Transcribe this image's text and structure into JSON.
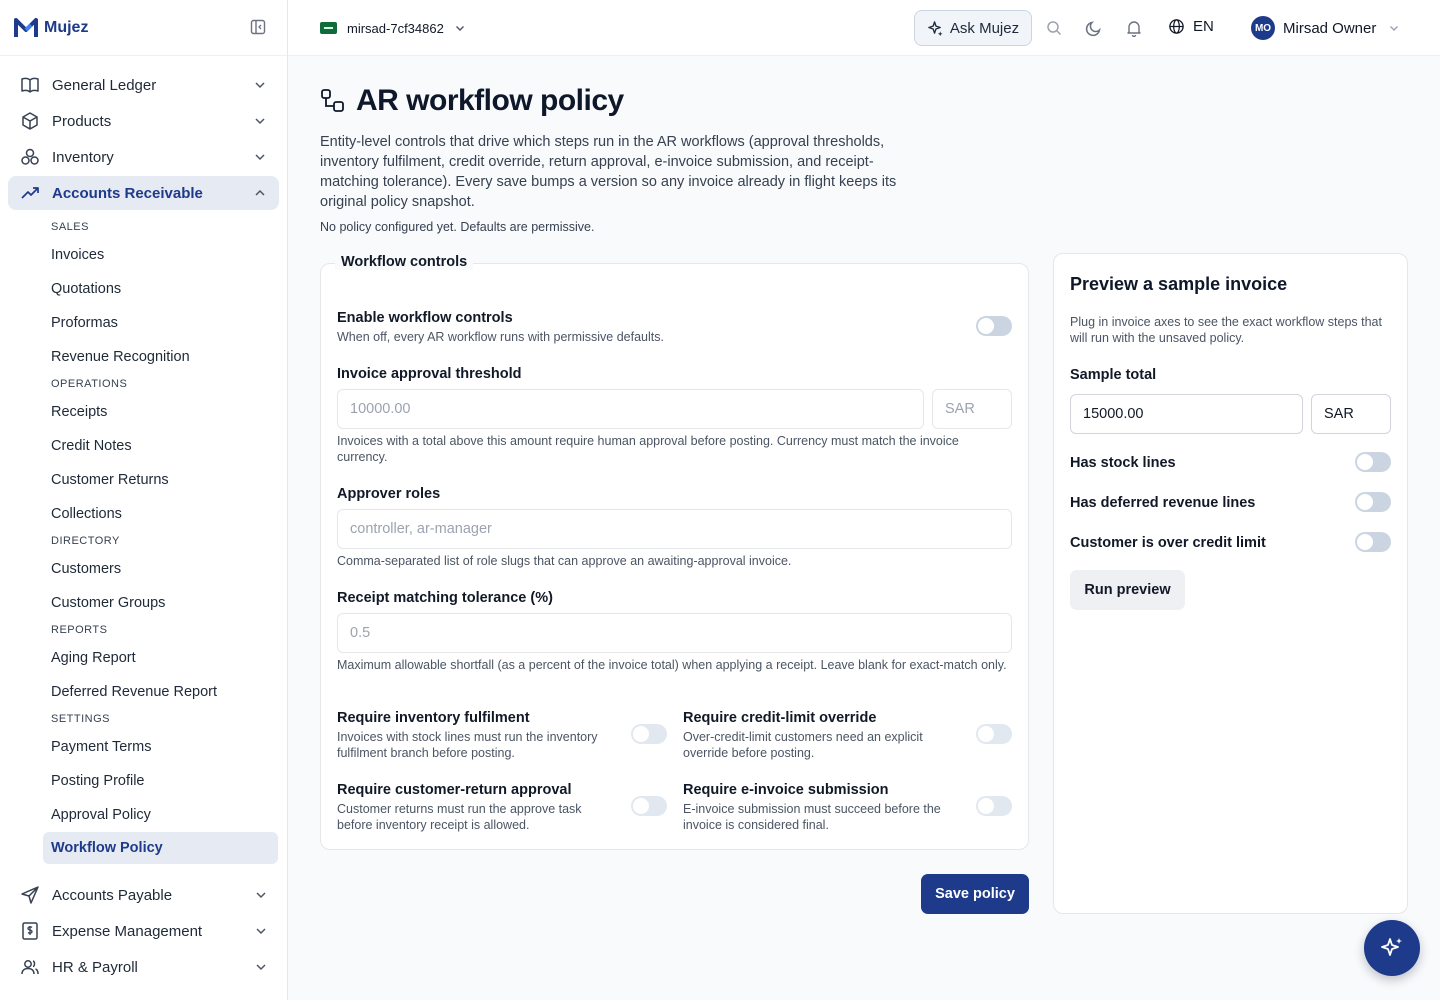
{
  "brand": {
    "name": "Mujez"
  },
  "topbar": {
    "entity": "mirsad-7cf34862",
    "ask_label": "Ask Mujez",
    "language": "EN",
    "user_initials": "MO",
    "user_name": "Mirsad Owner"
  },
  "sidebar": {
    "top_items": [
      {
        "label": "General Ledger",
        "icon": "book-icon"
      },
      {
        "label": "Products",
        "icon": "cube-icon"
      },
      {
        "label": "Inventory",
        "icon": "boxes-icon"
      },
      {
        "label": "Accounts Receivable",
        "icon": "trending-up-icon"
      }
    ],
    "ar_sections": [
      {
        "title": "SALES",
        "items": [
          "Invoices",
          "Quotations",
          "Proformas",
          "Revenue Recognition"
        ]
      },
      {
        "title": "OPERATIONS",
        "items": [
          "Receipts",
          "Credit Notes",
          "Customer Returns",
          "Collections"
        ]
      },
      {
        "title": "DIRECTORY",
        "items": [
          "Customers",
          "Customer Groups"
        ]
      },
      {
        "title": "REPORTS",
        "items": [
          "Aging Report",
          "Deferred Revenue Report"
        ]
      },
      {
        "title": "SETTINGS",
        "items": [
          "Payment Terms",
          "Posting Profile",
          "Approval Policy",
          "Workflow Policy"
        ]
      }
    ],
    "bottom_items": [
      {
        "label": "Accounts Payable",
        "icon": "send-icon"
      },
      {
        "label": "Expense Management",
        "icon": "receipt-icon"
      },
      {
        "label": "HR & Payroll",
        "icon": "users-icon"
      }
    ]
  },
  "page": {
    "title": "AR workflow policy",
    "description": "Entity-level controls that drive which steps run in the AR workflows (approval thresholds, inventory fulfilment, credit override, return approval, e-invoice submission, and receipt-matching tolerance). Every save bumps a version so any invoice already in flight keeps its original policy snapshot.",
    "note": "No policy configured yet. Defaults are permissive."
  },
  "workflow": {
    "legend": "Workflow controls",
    "enable_label": "Enable workflow controls",
    "enable_help": "When off, every AR workflow runs with permissive defaults.",
    "threshold_label": "Invoice approval threshold",
    "threshold_placeholder": "10000.00",
    "currency_placeholder": "SAR",
    "threshold_help": "Invoices with a total above this amount require human approval before posting. Currency must match the invoice currency.",
    "approver_label": "Approver roles",
    "approver_placeholder": "controller, ar-manager",
    "approver_help": "Comma-separated list of role slugs that can approve an awaiting-approval invoice.",
    "tolerance_label": "Receipt matching tolerance (%)",
    "tolerance_placeholder": "0.5",
    "tolerance_help": "Maximum allowable shortfall (as a percent of the invoice total) when applying a receipt. Leave blank for exact-match only.",
    "toggles": [
      {
        "label": "Require inventory fulfilment",
        "help": "Invoices with stock lines must run the inventory fulfilment branch before posting."
      },
      {
        "label": "Require credit-limit override",
        "help": "Over-credit-limit customers need an explicit override before posting."
      },
      {
        "label": "Require customer-return approval",
        "help": "Customer returns must run the approve task before inventory receipt is allowed."
      },
      {
        "label": "Require e-invoice submission",
        "help": "E-invoice submission must succeed before the invoice is considered final."
      }
    ],
    "save_label": "Save policy"
  },
  "preview": {
    "title": "Preview a sample invoice",
    "help": "Plug in invoice axes to see the exact workflow steps that will run with the unsaved policy.",
    "total_label": "Sample total",
    "total_value": "15000.00",
    "currency_value": "SAR",
    "toggles": [
      "Has stock lines",
      "Has deferred revenue lines",
      "Customer is over credit limit"
    ],
    "run_label": "Run preview"
  },
  "colors": {
    "primary": "#1e3a8a",
    "active_bg": "#e6eaf2",
    "toggle_off": "#cbd5e1"
  }
}
